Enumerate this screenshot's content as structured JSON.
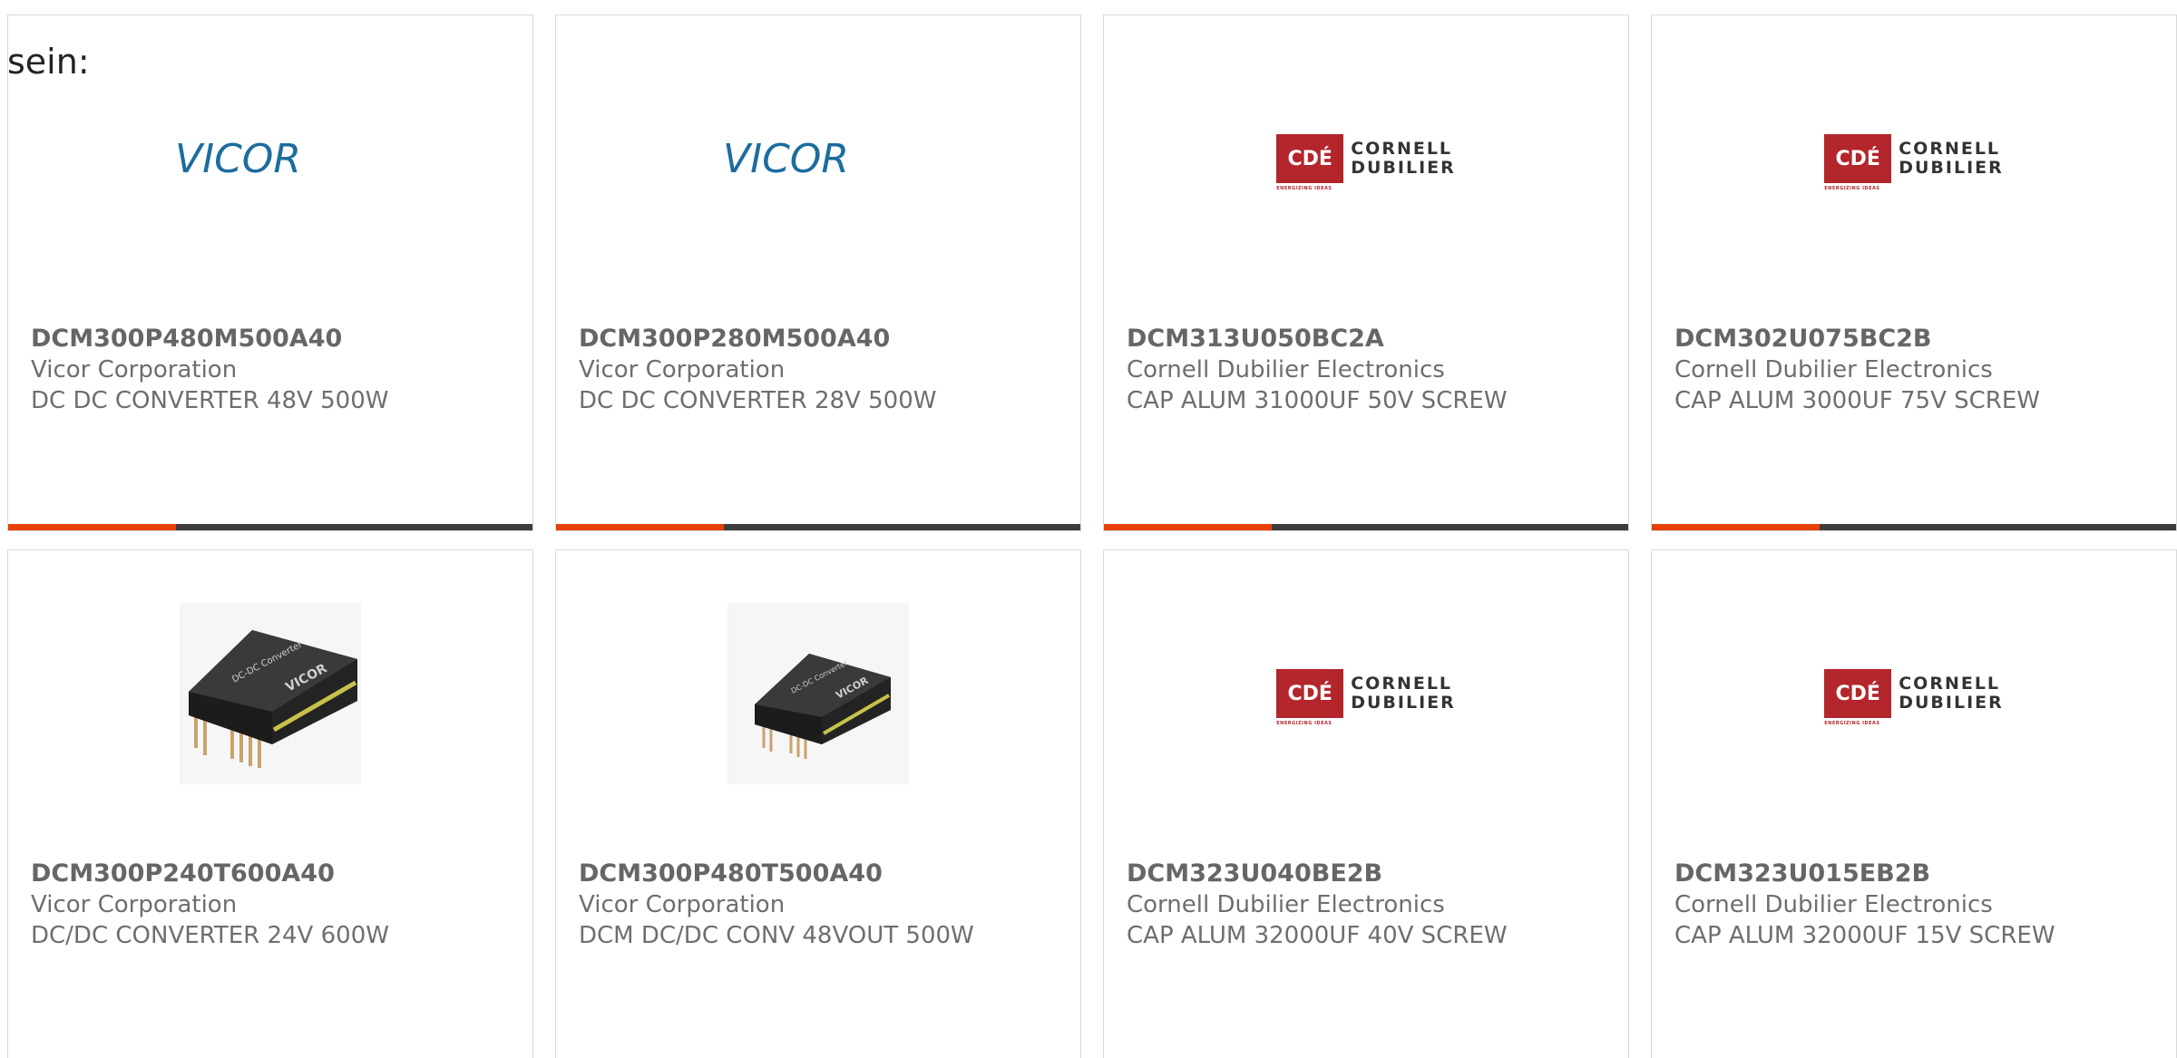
{
  "overlay_text": "sein:",
  "colors": {
    "accent": "#e8400a",
    "track": "#3d3d3d",
    "vicor_blue": "#1c6d9e",
    "cde_red": "#b3262b"
  },
  "cards": [
    {
      "part_number": "DCM300P480M500A40",
      "manufacturer": "Vicor Corporation",
      "description": "DC DC CONVERTER 48V 500W",
      "image": "vicor-logo",
      "logo_text": "VICOR",
      "progress": 0.32
    },
    {
      "part_number": "DCM300P280M500A40",
      "manufacturer": "Vicor Corporation",
      "description": "DC DC CONVERTER 28V 500W",
      "image": "vicor-logo",
      "logo_text": "VICOR",
      "progress": 0.32
    },
    {
      "part_number": "DCM313U050BC2A",
      "manufacturer": "Cornell Dubilier Electronics",
      "description": "CAP ALUM 31000UF 50V SCREW",
      "image": "cde-logo",
      "logo_box": "CDÉ",
      "logo_line1": "CORNELL",
      "logo_line2": "DUBILIER",
      "logo_tagline": "ENERGIZING IDEAS",
      "progress": 0.32
    },
    {
      "part_number": "DCM302U075BC2B",
      "manufacturer": "Cornell Dubilier Electronics",
      "description": "CAP ALUM 3000UF 75V SCREW",
      "image": "cde-logo",
      "logo_box": "CDÉ",
      "logo_line1": "CORNELL",
      "logo_line2": "DUBILIER",
      "logo_tagline": "ENERGIZING IDEAS",
      "progress": 0.32
    },
    {
      "part_number": "DCM300P240T600A40",
      "manufacturer": "Vicor Corporation",
      "description": "DC/DC CONVERTER 24V 600W",
      "image": "dc-converter-photo"
    },
    {
      "part_number": "DCM300P480T500A40",
      "manufacturer": "Vicor Corporation",
      "description": "DCM DC/DC CONV 48VOUT 500W",
      "image": "dc-converter-photo"
    },
    {
      "part_number": "DCM323U040BE2B",
      "manufacturer": "Cornell Dubilier Electronics",
      "description": "CAP ALUM 32000UF 40V SCREW",
      "image": "cde-logo",
      "logo_box": "CDÉ",
      "logo_line1": "CORNELL",
      "logo_line2": "DUBILIER",
      "logo_tagline": "ENERGIZING IDEAS"
    },
    {
      "part_number": "DCM323U015EB2B",
      "manufacturer": "Cornell Dubilier Electronics",
      "description": "CAP ALUM 32000UF 15V SCREW",
      "image": "cde-logo",
      "logo_box": "CDÉ",
      "logo_line1": "CORNELL",
      "logo_line2": "DUBILIER",
      "logo_tagline": "ENERGIZING IDEAS"
    }
  ]
}
